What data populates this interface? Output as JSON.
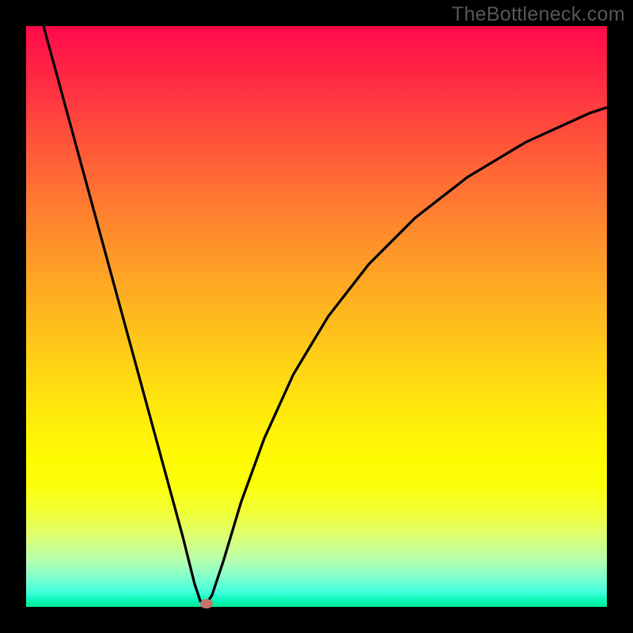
{
  "watermark": "TheBottleneck.com",
  "chart_data": {
    "type": "line",
    "title": "",
    "xlabel": "",
    "ylabel": "",
    "xlim": [
      0,
      100
    ],
    "ylim": [
      0,
      100
    ],
    "grid": false,
    "legend": false,
    "series": [
      {
        "name": "bottleneck-curve",
        "x": [
          3,
          6,
          9,
          12,
          15,
          18,
          21,
          24,
          27,
          29,
          30,
          31,
          32,
          34,
          37,
          41,
          46,
          52,
          59,
          67,
          76,
          86,
          97,
          100
        ],
        "y": [
          100,
          89,
          78,
          67,
          56,
          45,
          34,
          23,
          12,
          4,
          1,
          0.5,
          2,
          8,
          18,
          29,
          40,
          50,
          59,
          67,
          74,
          80,
          85,
          86
        ]
      }
    ],
    "marker": {
      "x": 31,
      "y": 0.5,
      "color": "#c4736a"
    },
    "gradient_stops": [
      {
        "pos": 0,
        "color": "#ff0a4a"
      },
      {
        "pos": 50,
        "color": "#ffc020"
      },
      {
        "pos": 78,
        "color": "#ffff00"
      },
      {
        "pos": 100,
        "color": "#00e890"
      }
    ]
  }
}
